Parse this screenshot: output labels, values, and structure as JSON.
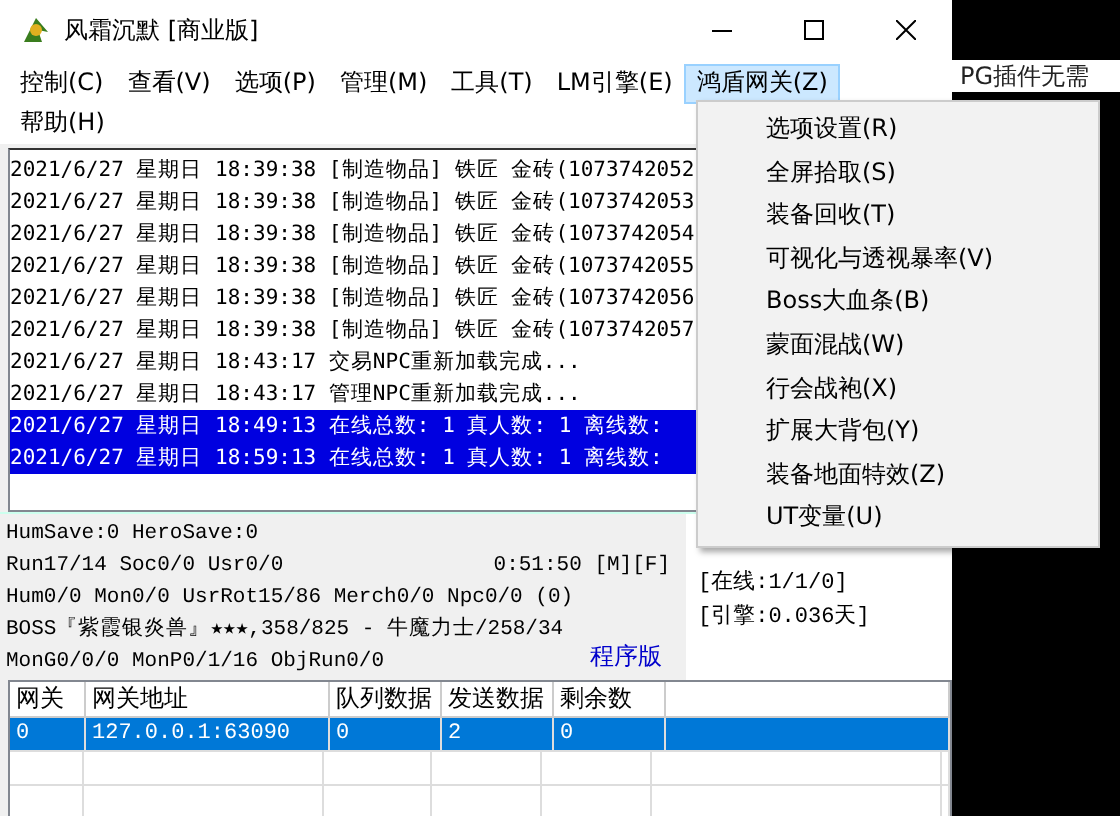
{
  "window": {
    "title": "风霜沉默 [商业版]"
  },
  "background_text": "PG插件无需",
  "menu_bar": [
    {
      "label": "控制(C)",
      "selected": false
    },
    {
      "label": "查看(V)",
      "selected": false
    },
    {
      "label": "选项(P)",
      "selected": false
    },
    {
      "label": "管理(M)",
      "selected": false
    },
    {
      "label": "工具(T)",
      "selected": false
    },
    {
      "label": "LM引擎(E)",
      "selected": false
    },
    {
      "label": "鸿盾网关(Z)",
      "selected": true
    },
    {
      "label": "帮助(H)",
      "selected": false
    }
  ],
  "dropdown": [
    "选项设置(R)",
    "全屏拾取(S)",
    "装备回收(T)",
    "可视化与透视暴率(V)",
    "Boss大血条(B)",
    "蒙面混战(W)",
    "行会战袍(X)",
    "扩展大背包(Y)",
    "装备地面特效(Z)",
    "UT变量(U)"
  ],
  "log": [
    {
      "text": "2021/6/27 星期日 18:39:38 [制造物品] 铁匠 金砖(1073742052",
      "selected": false
    },
    {
      "text": "2021/6/27 星期日 18:39:38 [制造物品] 铁匠 金砖(1073742053",
      "selected": false
    },
    {
      "text": "2021/6/27 星期日 18:39:38 [制造物品] 铁匠 金砖(1073742054",
      "selected": false
    },
    {
      "text": "2021/6/27 星期日 18:39:38 [制造物品] 铁匠 金砖(1073742055",
      "selected": false
    },
    {
      "text": "2021/6/27 星期日 18:39:38 [制造物品] 铁匠 金砖(1073742056",
      "selected": false
    },
    {
      "text": "2021/6/27 星期日 18:39:38 [制造物品] 铁匠 金砖(1073742057",
      "selected": false
    },
    {
      "text": "2021/6/27 星期日 18:43:17 交易NPC重新加载完成...",
      "selected": false
    },
    {
      "text": "2021/6/27 星期日 18:43:17 管理NPC重新加载完成...",
      "selected": false
    },
    {
      "text": "2021/6/27 星期日 18:49:13 在线总数: 1 真人数: 1 离线数:",
      "selected": true
    },
    {
      "text": "2021/6/27 星期日 18:59:13 在线总数: 1 真人数: 1 离线数:",
      "selected": true
    }
  ],
  "status_lines": [
    {
      "text": "HumSave:0 HeroSave:0"
    },
    {
      "text": "Run17/14 Soc0/0 Usr0/0",
      "extra": "0:51:50 [M][F]"
    },
    {
      "text": "Hum0/0 Mon0/0 UsrRot15/86 Merch0/0 Npc0/0 (0)"
    },
    {
      "text": "BOSS『紫霞银炎兽』★★★,358/825 - 牛魔力士/258/34"
    },
    {
      "text": "MonG0/0/0 MonP0/1/16 ObjRun0/0"
    }
  ],
  "side_labels": [
    "[在线:1/1/0]",
    "[引擎:0.036天]"
  ],
  "version_text": "程序版",
  "table": {
    "columns": [
      "网关",
      "网关地址",
      "队列数据",
      "发送数据",
      "剩余数"
    ],
    "rows": [
      {
        "cells": [
          "0",
          "127.0.0.1:63090",
          "0",
          "2",
          "0"
        ],
        "selected": true
      }
    ]
  }
}
